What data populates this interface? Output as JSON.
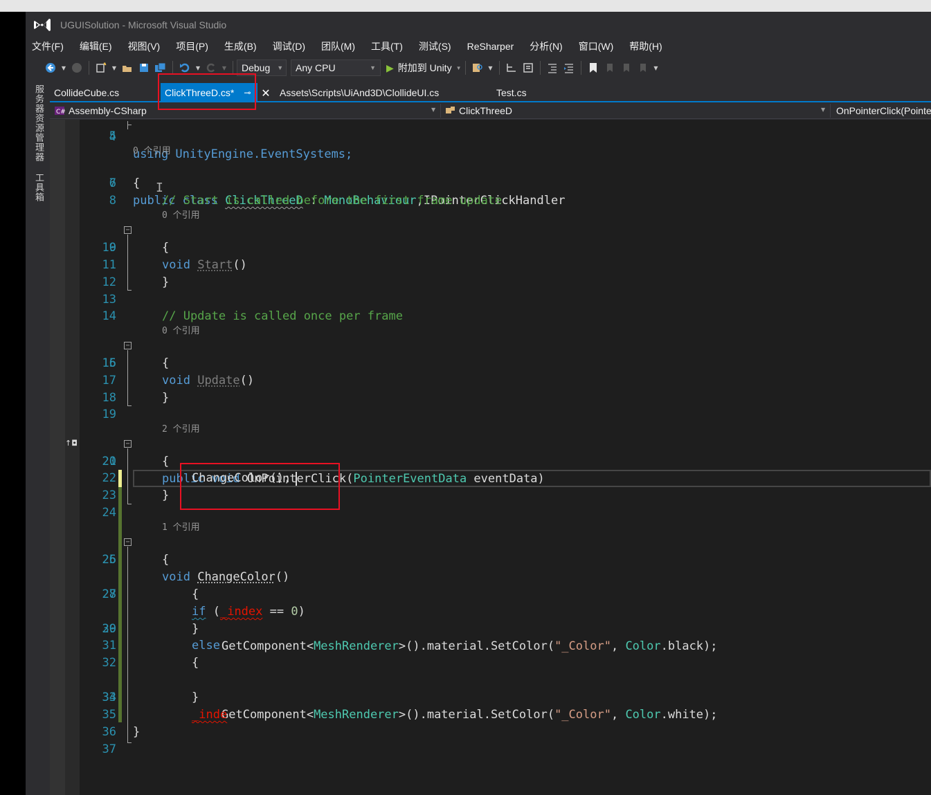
{
  "window": {
    "title": "UGUISolution - Microsoft Visual Studio"
  },
  "menu": [
    "文件(F)",
    "编辑(E)",
    "视图(V)",
    "项目(P)",
    "生成(B)",
    "调试(D)",
    "团队(M)",
    "工具(T)",
    "测试(S)",
    "ReSharper",
    "分析(N)",
    "窗口(W)",
    "帮助(H)"
  ],
  "toolbar": {
    "configuration": "Debug",
    "platform": "Any CPU",
    "attach_label": "附加到 Unity"
  },
  "side_tabs": [
    "服务器资源管理器",
    "工具箱"
  ],
  "tabs": [
    {
      "label": "CollideCube.cs",
      "active": false
    },
    {
      "label": "ClickThreeD.cs*",
      "active": true
    },
    {
      "label": "Assets\\Scripts\\UiAnd3D\\ClollideUI.cs",
      "active": false
    },
    {
      "label": "Test.cs",
      "active": false
    }
  ],
  "nav": {
    "project": "Assembly-CSharp",
    "class": "ClickThreeD",
    "member": "OnPointerClick(PointerEventData eventData)"
  },
  "code": {
    "line4": {
      "n": "4",
      "text": "using UnityEngine.EventSystems;"
    },
    "line5": {
      "n": "5"
    },
    "lens_class": "0 个引用",
    "line6": {
      "n": "6",
      "kw1": "public",
      "kw2": "class",
      "name": "ClickThreeD",
      "colon": " : ",
      "base1": "MonoBehaviour",
      "comma": ",",
      "base2": "IPointerClickHandler"
    },
    "line7": {
      "n": "7",
      "text": "{"
    },
    "line8": {
      "n": "8",
      "comment": "// Start is called before the first frame update"
    },
    "lens_start": "0 个引用",
    "line9": {
      "n": "9",
      "kw": "void",
      "name": "Start",
      "tail": "()"
    },
    "line10": {
      "n": "10",
      "text": "{"
    },
    "line11": {
      "n": "11"
    },
    "line12": {
      "n": "12",
      "text": "}"
    },
    "line13": {
      "n": "13"
    },
    "line14": {
      "n": "14",
      "comment": "// Update is called once per frame"
    },
    "lens_update": "0 个引用",
    "line15": {
      "n": "15",
      "kw": "void",
      "name": "Update",
      "tail": "()"
    },
    "line16": {
      "n": "16",
      "text": "{"
    },
    "line17": {
      "n": "17"
    },
    "line18": {
      "n": "18",
      "text": "}"
    },
    "line19": {
      "n": "19"
    },
    "lens_click": "2 个引用",
    "line20": {
      "n": "20",
      "kw1": "public",
      "kw2": "void",
      "name": "OnPointerClick",
      "open": "(",
      "ptype": "PointerEventData",
      "pname": " eventData)"
    },
    "line21": {
      "n": "21",
      "text": "{"
    },
    "line22": {
      "n": "22",
      "text": "ChangeColor();"
    },
    "line23": {
      "n": "23",
      "text": "}"
    },
    "line24": {
      "n": "24"
    },
    "lens_change": "1 个引用",
    "line25": {
      "n": "25",
      "kw": "void",
      "name": "ChangeColor",
      "tail": "()"
    },
    "line26": {
      "n": "26",
      "text": "{"
    },
    "line27": {
      "n": "27",
      "kw": "if",
      "open": " (",
      "ident": "_index",
      "tail": " == ",
      "num": "0",
      "close": ")"
    },
    "line28": {
      "n": "28",
      "text": "{"
    },
    "line29": {
      "n": "29",
      "pre": "GetComponent<",
      "type": "MeshRenderer",
      "mid": ">().material.SetColor(",
      "str": "\"_Color\"",
      "sep": ", ",
      "cls": "Color",
      "tail": ".black);"
    },
    "line30": {
      "n": "30",
      "text": "}"
    },
    "line31": {
      "n": "31",
      "kw": "else"
    },
    "line32": {
      "n": "32",
      "text": "{"
    },
    "line33": {
      "n": "33",
      "pre": "GetComponent<",
      "type": "MeshRenderer",
      "mid": ">().material.SetColor(",
      "str": "\"_Color\"",
      "sep": ", ",
      "cls": "Color",
      "tail": ".white);"
    },
    "line34": {
      "n": "34",
      "text": "}"
    },
    "line35": {
      "n": "35",
      "text": "_inde"
    },
    "line36": {
      "n": "36",
      "text": "}"
    },
    "line37": {
      "n": "37"
    }
  },
  "colors": {
    "accent": "#007acc",
    "highlight_box": "#e81123",
    "keyword": "#569cd6",
    "type": "#4ec9b0",
    "comment": "#57a64a",
    "string": "#d69d85",
    "line_number": "#2b91af"
  }
}
